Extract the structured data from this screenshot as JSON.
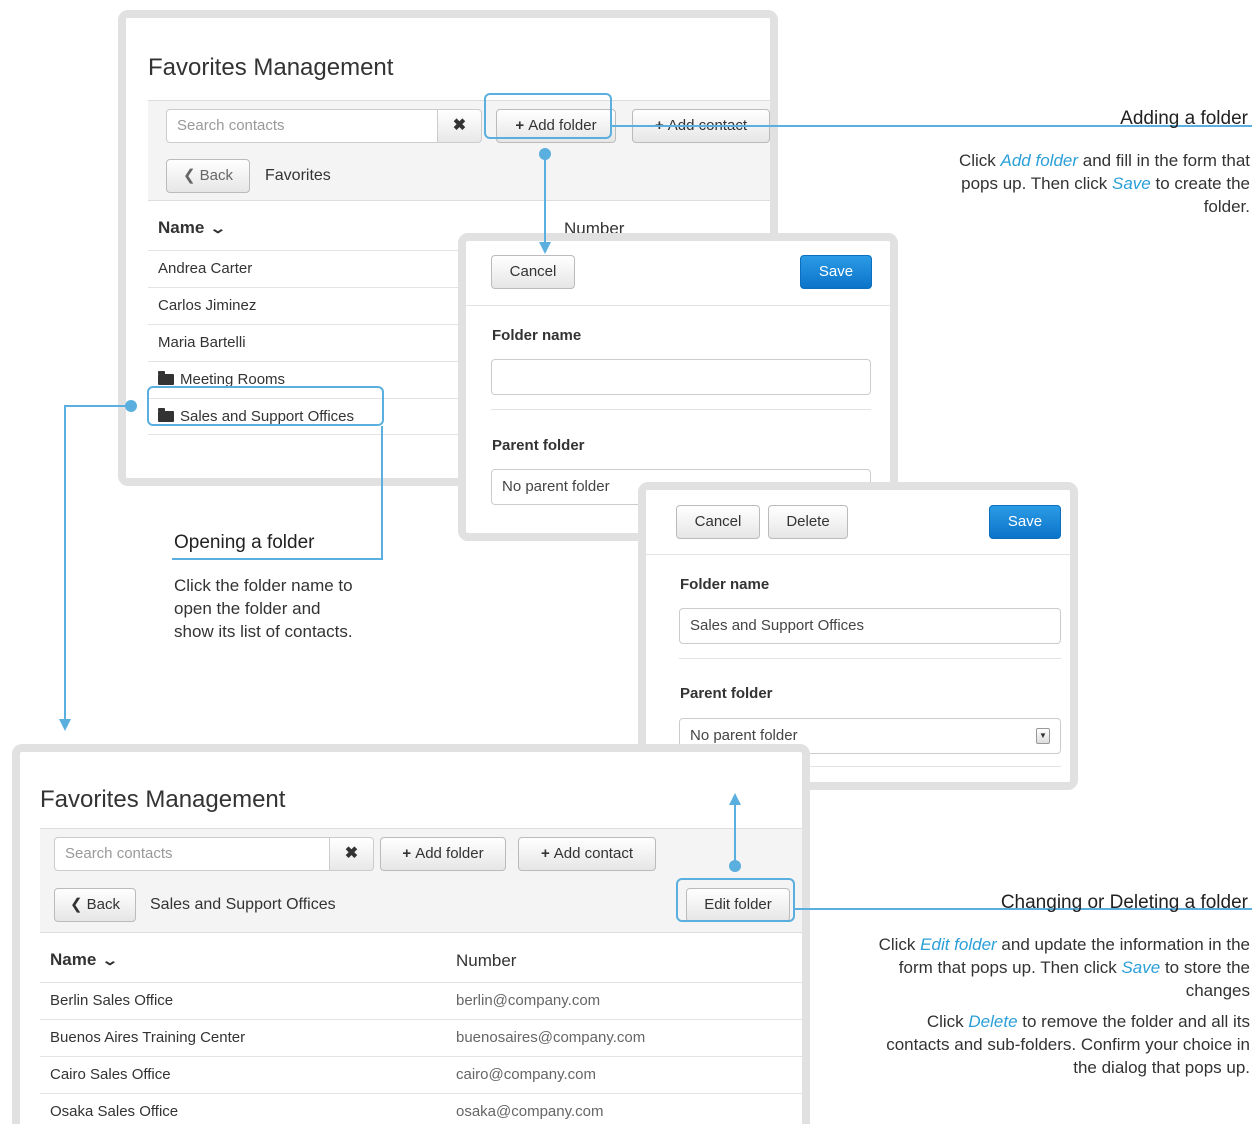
{
  "top_panel": {
    "title": "Favorites Management",
    "search_placeholder": "Search contacts",
    "clear_label": "✖",
    "add_folder_label": "Add folder",
    "add_contact_label": "Add contact",
    "back_label": "Back",
    "breadcrumb": "Favorites",
    "col_name": "Name",
    "col_number": "Number",
    "rows": [
      {
        "name": "Andrea Carter",
        "folder": false
      },
      {
        "name": "Carlos Jiminez",
        "folder": false
      },
      {
        "name": "Maria Bartelli",
        "folder": false
      },
      {
        "name": "Meeting Rooms",
        "folder": true
      },
      {
        "name": "Sales and Support Offices",
        "folder": true
      }
    ]
  },
  "add_folder_dialog": {
    "cancel_label": "Cancel",
    "save_label": "Save",
    "folder_name_label": "Folder name",
    "folder_name_value": "",
    "parent_folder_label": "Parent folder",
    "parent_folder_value": "No parent folder"
  },
  "edit_folder_dialog": {
    "cancel_label": "Cancel",
    "delete_label": "Delete",
    "save_label": "Save",
    "folder_name_label": "Folder name",
    "folder_name_value": "Sales and Support Offices",
    "parent_folder_label": "Parent folder",
    "parent_folder_value": "No parent folder"
  },
  "bottom_panel": {
    "title": "Favorites Management",
    "search_placeholder": "Search contacts",
    "clear_label": "✖",
    "add_folder_label": "Add folder",
    "add_contact_label": "Add contact",
    "back_label": "Back",
    "breadcrumb": "Sales and Support Offices",
    "edit_folder_label": "Edit folder",
    "col_name": "Name",
    "col_number": "Number",
    "rows": [
      {
        "name": "Berlin Sales Office",
        "number": "berlin@company.com"
      },
      {
        "name": "Buenos Aires Training Center",
        "number": "buenosaires@company.com"
      },
      {
        "name": "Cairo Sales Office",
        "number": "cairo@company.com"
      },
      {
        "name": "Osaka Sales Office",
        "number": "osaka@company.com"
      }
    ]
  },
  "annotations": {
    "adding": {
      "title": "Adding a folder",
      "t1": "Click ",
      "e1": "Add folder",
      "t2": " and fill in the form that pops up. Then click ",
      "e2": "Save",
      "t3": " to create the folder."
    },
    "opening": {
      "title": "Opening a folder",
      "text": "Click the folder name to open the folder and show its list of contacts."
    },
    "changing": {
      "title": "Changing or Deleting a folder",
      "t1": "Click ",
      "e1": "Edit folder",
      "t2": " and update the information in the form that pops up. Then click ",
      "e2": "Save",
      "t3": " to store the changes",
      "d1": "Click ",
      "de": "Delete",
      "d2": " to remove the folder and all its contacts and sub-folders. Confirm your choice in the dialog that pops up."
    }
  },
  "colors": {
    "accent": "#5aafde",
    "primary_button": "#0b74c9",
    "panel_border": "#e1e1e1"
  }
}
